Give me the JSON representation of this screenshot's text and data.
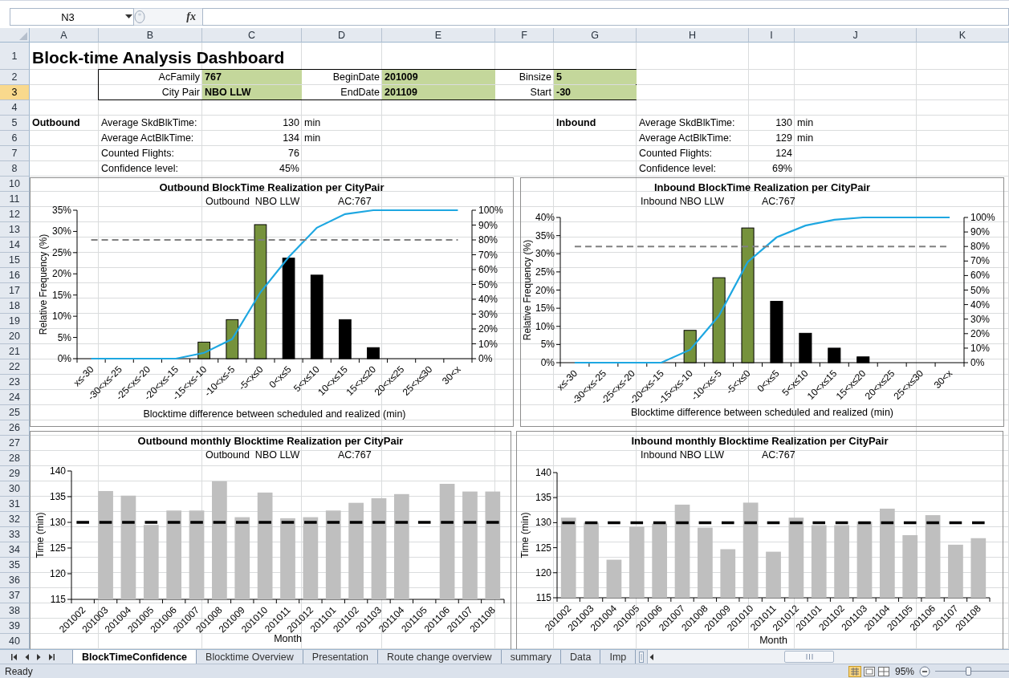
{
  "name_box": "N3",
  "formula_bar": {
    "fx": "fx"
  },
  "columns": [
    "A",
    "B",
    "C",
    "D",
    "E",
    "F",
    "G",
    "H",
    "I",
    "J",
    "K"
  ],
  "rows": [
    {
      "label": "1",
      "selected": false
    },
    {
      "label": "2",
      "selected": false
    },
    {
      "label": "3",
      "selected": true
    },
    {
      "label": "4",
      "selected": false
    },
    {
      "label": "5",
      "selected": false
    },
    {
      "label": "6",
      "selected": false
    },
    {
      "label": "7",
      "selected": false
    },
    {
      "label": "8",
      "selected": false
    },
    {
      "label": "10",
      "selected": false
    },
    {
      "label": "11",
      "selected": false
    },
    {
      "label": "12",
      "selected": false
    },
    {
      "label": "13",
      "selected": false
    },
    {
      "label": "14",
      "selected": false
    },
    {
      "label": "15",
      "selected": false
    },
    {
      "label": "16",
      "selected": false
    },
    {
      "label": "17",
      "selected": false
    },
    {
      "label": "18",
      "selected": false
    },
    {
      "label": "19",
      "selected": false
    },
    {
      "label": "20",
      "selected": false
    },
    {
      "label": "21",
      "selected": false
    },
    {
      "label": "22",
      "selected": false
    },
    {
      "label": "23",
      "selected": false
    },
    {
      "label": "24",
      "selected": false
    },
    {
      "label": "25",
      "selected": false
    },
    {
      "label": "26",
      "selected": false
    },
    {
      "label": "27",
      "selected": false
    },
    {
      "label": "28",
      "selected": false
    },
    {
      "label": "29",
      "selected": false
    },
    {
      "label": "30",
      "selected": false
    },
    {
      "label": "31",
      "selected": false
    },
    {
      "label": "32",
      "selected": false
    },
    {
      "label": "33",
      "selected": false
    },
    {
      "label": "34",
      "selected": false
    },
    {
      "label": "35",
      "selected": false
    },
    {
      "label": "36",
      "selected": false
    },
    {
      "label": "37",
      "selected": false
    },
    {
      "label": "38",
      "selected": false
    },
    {
      "label": "39",
      "selected": false
    },
    {
      "label": "40",
      "selected": false
    }
  ],
  "title": "Block-time Analysis Dashboard",
  "parameters": [
    {
      "label": "AcFamily",
      "value": "767"
    },
    {
      "label": "City Pair",
      "value": "NBO LLW"
    },
    {
      "label": "BeginDate",
      "value": "201009"
    },
    {
      "label": "EndDate",
      "value": "201109"
    },
    {
      "label": "Binsize",
      "value": "5"
    },
    {
      "label": "Start",
      "value": "-30"
    }
  ],
  "summaries": [
    {
      "heading": "Outbound",
      "stats": [
        {
          "label": "Average SkdBlkTime:",
          "value": "130",
          "unit": "min"
        },
        {
          "label": "Average ActBlkTime:",
          "value": "134",
          "unit": "min"
        },
        {
          "label": "Counted Flights:",
          "value": "76"
        },
        {
          "label": "Confidence level:",
          "value": "45%"
        }
      ]
    },
    {
      "heading": "Inbound",
      "stats": [
        {
          "label": "Average SkdBlkTime:",
          "value": "130",
          "unit": "min"
        },
        {
          "label": "Average ActBlkTime:",
          "value": "129",
          "unit": "min"
        },
        {
          "label": "Counted Flights:",
          "value": "124"
        },
        {
          "label": "Confidence level:",
          "value": "69%"
        }
      ]
    }
  ],
  "charts": [
    {
      "labels": [
        "Outbound  NBO LLW",
        "AC:767"
      ],
      "chart_data": {
        "type": "bar",
        "title": "Outbound BlockTime Realization per CityPair",
        "xlabel": "Blocktime difference between scheduled and realized (min)",
        "ylabel": "Relative Frequency (%)",
        "categories": [
          "x≤-30",
          "-30<x≤-25",
          "-25<x≤-20",
          "-20<x≤-15",
          "-15<x≤-10",
          "-10<x≤-5",
          "-5<x≤0",
          "0<x≤5",
          "5<x≤10",
          "10<x≤15",
          "15<x≤20",
          "20<x≤25",
          "25<x≤30",
          "30<x"
        ],
        "ylim": [
          0,
          35
        ],
        "yticks": [
          {
            "value": 0,
            "label": "0%"
          },
          {
            "value": 5,
            "label": "5%"
          },
          {
            "value": 10,
            "label": "10%"
          },
          {
            "value": 15,
            "label": "15%"
          },
          {
            "value": 20,
            "label": "20%"
          },
          {
            "value": 25,
            "label": "25%"
          },
          {
            "value": 30,
            "label": "30%"
          },
          {
            "value": 35,
            "label": "35%"
          }
        ],
        "y2lim": [
          0,
          100
        ],
        "y2ticks": [
          {
            "value": 0,
            "label": "0%"
          },
          {
            "value": 10,
            "label": "10%"
          },
          {
            "value": 20,
            "label": "20%"
          },
          {
            "value": 30,
            "label": "30%"
          },
          {
            "value": 40,
            "label": "40%"
          },
          {
            "value": 50,
            "label": "50%"
          },
          {
            "value": 60,
            "label": "60%"
          },
          {
            "value": 70,
            "label": "70%"
          },
          {
            "value": 80,
            "label": "80%"
          },
          {
            "value": 90,
            "label": "90%"
          },
          {
            "value": 100,
            "label": "100%"
          }
        ],
        "series": [
          {
            "color": "#76923c",
            "values": [
              null,
              null,
              null,
              null,
              3.9,
              9.2,
              31.6,
              null,
              null,
              null,
              null,
              null,
              null,
              null
            ]
          },
          {
            "color": "#000000",
            "values": [
              null,
              null,
              null,
              null,
              null,
              null,
              null,
              23.7,
              19.7,
              9.2,
              2.6,
              null,
              null,
              null
            ]
          },
          {
            "type": "line",
            "axis": "y2",
            "color": "#1ea7e1",
            "values": [
              0,
              0,
              0,
              0,
              3.9,
              13.2,
              44.7,
              68.4,
              88.2,
              97.4,
              100,
              100,
              100,
              100
            ]
          }
        ],
        "ref_lines": [
          {
            "value": 80,
            "axis": "y2",
            "color": "#808080"
          }
        ]
      }
    },
    {
      "labels": [
        "Inbound NBO LLW",
        "AC:767"
      ],
      "chart_data": {
        "type": "bar",
        "title": "Inbound BlockTime Realization per CityPair",
        "xlabel": "Blocktime difference between scheduled and realized (min)",
        "ylabel": "Relative Frequency (%)",
        "categories": [
          "x≤-30",
          "-30<x≤-25",
          "-25<x≤-20",
          "-20<x≤-15",
          "-15<x≤-10",
          "-10<x≤-5",
          "-5<x≤0",
          "0<x≤5",
          "5<x≤10",
          "10<x≤15",
          "15<x≤20",
          "20<x≤25",
          "25<x≤30",
          "30<x"
        ],
        "ylim": [
          0,
          40
        ],
        "yticks": [
          {
            "value": 0,
            "label": "0%"
          },
          {
            "value": 5,
            "label": "5%"
          },
          {
            "value": 10,
            "label": "10%"
          },
          {
            "value": 15,
            "label": "15%"
          },
          {
            "value": 20,
            "label": "20%"
          },
          {
            "value": 25,
            "label": "25%"
          },
          {
            "value": 30,
            "label": "30%"
          },
          {
            "value": 35,
            "label": "35%"
          },
          {
            "value": 40,
            "label": "40%"
          }
        ],
        "y2lim": [
          0,
          100
        ],
        "y2ticks": [
          {
            "value": 0,
            "label": "0%"
          },
          {
            "value": 10,
            "label": "10%"
          },
          {
            "value": 20,
            "label": "20%"
          },
          {
            "value": 30,
            "label": "30%"
          },
          {
            "value": 40,
            "label": "40%"
          },
          {
            "value": 50,
            "label": "50%"
          },
          {
            "value": 60,
            "label": "60%"
          },
          {
            "value": 70,
            "label": "70%"
          },
          {
            "value": 80,
            "label": "80%"
          },
          {
            "value": 90,
            "label": "90%"
          },
          {
            "value": 100,
            "label": "100%"
          }
        ],
        "series": [
          {
            "color": "#76923c",
            "values": [
              null,
              null,
              null,
              null,
              8.9,
              23.4,
              37.1,
              null,
              null,
              null,
              null,
              null,
              null,
              null
            ]
          },
          {
            "color": "#000000",
            "values": [
              null,
              null,
              null,
              null,
              null,
              null,
              null,
              16.9,
              8.1,
              4.0,
              1.6,
              null,
              null,
              null
            ]
          },
          {
            "type": "line",
            "axis": "y2",
            "color": "#1ea7e1",
            "values": [
              0,
              0,
              0,
              0,
              8.9,
              32.3,
              69.4,
              86.3,
              94.4,
              98.4,
              100,
              100,
              100,
              100
            ]
          }
        ],
        "ref_lines": [
          {
            "value": 80,
            "axis": "y2",
            "color": "#808080"
          }
        ]
      }
    },
    {
      "labels": [
        "Outbound  NBO LLW",
        "AC:767"
      ],
      "chart_data": {
        "type": "bar",
        "title": "Outbound monthly Blocktime Realization per CityPair",
        "xlabel": "Month",
        "ylabel": "Time (min)",
        "categories": [
          "201002",
          "201003",
          "201004",
          "201005",
          "201006",
          "201007",
          "201008",
          "201009",
          "201010",
          "201011",
          "201012",
          "201101",
          "201102",
          "201103",
          "201104",
          "201105",
          "201106",
          "201107",
          "201108"
        ],
        "ylim": [
          115,
          140
        ],
        "yticks": [
          115,
          120,
          125,
          130,
          135,
          140
        ],
        "series": [
          {
            "color": "#bfbfbf",
            "values": [
              null,
              136.1,
              135.2,
              129.5,
              132.3,
              132.3,
              138,
              131,
              135.8,
              130.8,
              131,
              132.3,
              133.8,
              134.7,
              135.5,
              null,
              137.5,
              136,
              136
            ]
          }
        ],
        "ref_lines": [
          {
            "value": 130,
            "axis": "y",
            "color": "#000000"
          }
        ]
      }
    },
    {
      "labels": [
        "Inbound NBO LLW",
        "AC:767"
      ],
      "chart_data": {
        "type": "bar",
        "title": "Inbound monthly Blocktime Realization per CityPair",
        "xlabel": "Month",
        "ylabel": "Time (min)",
        "categories": [
          "201002",
          "201003",
          "201004",
          "201005",
          "201006",
          "201007",
          "201008",
          "201009",
          "201010",
          "201011",
          "201012",
          "201101",
          "201102",
          "201103",
          "201104",
          "201105",
          "201106",
          "201107",
          "201108"
        ],
        "ylim": [
          115,
          140
        ],
        "yticks": [
          115,
          120,
          125,
          130,
          135,
          140
        ],
        "series": [
          {
            "color": "#bfbfbf",
            "values": [
              131,
              130,
              122.6,
              129.2,
              129.8,
              133.6,
              129,
              124.7,
              134,
              124.2,
              131,
              129.5,
              129.5,
              130.2,
              132.8,
              127.5,
              131.5,
              125.6,
              126.9
            ]
          }
        ],
        "ref_lines": [
          {
            "value": 130,
            "axis": "y",
            "color": "#000000"
          }
        ]
      }
    }
  ],
  "sheet_tabs": [
    {
      "label": "BlockTimeConfidence",
      "selected": true
    },
    {
      "label": "Blocktime Overview",
      "selected": false
    },
    {
      "label": "Presentation",
      "selected": false
    },
    {
      "label": "Route change overview",
      "selected": false
    },
    {
      "label": "summary",
      "selected": false
    },
    {
      "label": "Data",
      "selected": false
    },
    {
      "label": "Imp",
      "selected": false
    }
  ],
  "status_bar": {
    "status": "Ready",
    "zoom": "95%",
    "zoom_slider": {
      "level": 0.45
    }
  }
}
